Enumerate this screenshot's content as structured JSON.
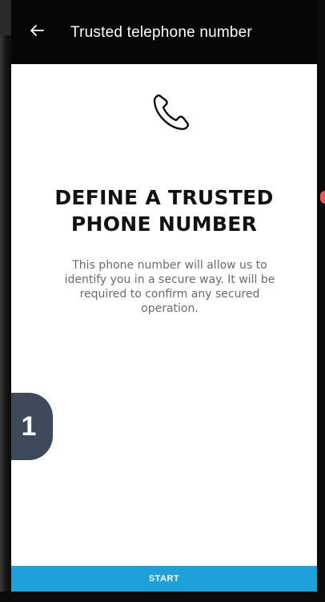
{
  "appbar": {
    "title": "Trusted telephone number",
    "back_icon": "arrow-left-icon",
    "background": "#050505"
  },
  "content": {
    "icon": "phone-icon",
    "heading_line1": "DEFINE A TRUSTED",
    "heading_line2": "PHONE NUMBER",
    "description": "This phone number will allow us to identify you in a secure way. It will be required to confirm any secured operation."
  },
  "step_badge": {
    "label": "1",
    "color": "#3d4a5c"
  },
  "footer": {
    "start_label": "START",
    "button_color": "#1da1d8"
  }
}
